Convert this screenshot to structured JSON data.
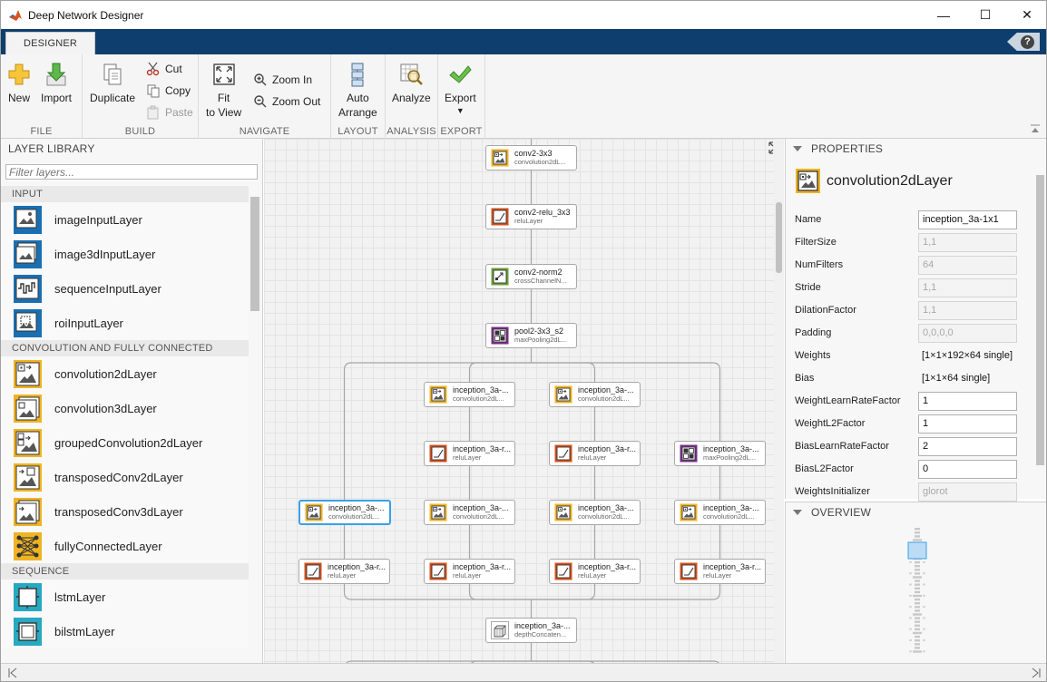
{
  "window": {
    "title": "Deep Network Designer",
    "minimize_symbol": "—",
    "maximize_symbol": "☐",
    "close_symbol": "✕"
  },
  "tab": {
    "label": "DESIGNER"
  },
  "help": {
    "symbol": "?"
  },
  "toolstrip": {
    "file": {
      "label": "FILE",
      "new": "New",
      "import": "Import"
    },
    "build": {
      "label": "BUILD",
      "duplicate": "Duplicate",
      "cut": "Cut",
      "copy": "Copy",
      "paste": "Paste"
    },
    "navigate": {
      "label": "NAVIGATE",
      "fit_line1": "Fit",
      "fit_line2": "to View",
      "zoom_in": "Zoom In",
      "zoom_out": "Zoom Out"
    },
    "layout": {
      "label": "LAYOUT",
      "auto_line1": "Auto",
      "auto_line2": "Arrange"
    },
    "analysis": {
      "label": "ANALYSIS",
      "analyze": "Analyze"
    },
    "export": {
      "label": "EXPORT",
      "export": "Export"
    }
  },
  "library": {
    "title": "LAYER LIBRARY",
    "filter_placeholder": "Filter layers...",
    "categories": [
      {
        "name": "INPUT",
        "color": "#1a6fb3",
        "layers": [
          "imageInputLayer",
          "image3dInputLayer",
          "sequenceInputLayer",
          "roiInputLayer"
        ]
      },
      {
        "name": "CONVOLUTION AND FULLY CONNECTED",
        "color": "#f0b323",
        "layers": [
          "convolution2dLayer",
          "convolution3dLayer",
          "groupedConvolution2dLayer",
          "transposedConv2dLayer",
          "transposedConv3dLayer",
          "fullyConnectedLayer"
        ]
      },
      {
        "name": "SEQUENCE",
        "color": "#27a9c2",
        "layers": [
          "lstmLayer",
          "bilstmLayer"
        ]
      }
    ]
  },
  "network": {
    "nodes": [
      {
        "name": "conv2-3x3",
        "type": "convolution2dL...",
        "kind": "conv"
      },
      {
        "name": "conv2-relu_3x3",
        "type": "reluLayer",
        "kind": "relu"
      },
      {
        "name": "conv2-norm2",
        "type": "crossChannelN...",
        "kind": "norm"
      },
      {
        "name": "pool2-3x3_s2",
        "type": "maxPooling2dL...",
        "kind": "pool"
      },
      {
        "name": "inception_3a-...",
        "type": "convolution2dL...",
        "kind": "conv"
      },
      {
        "name": "inception_3a-...",
        "type": "convolution2dL...",
        "kind": "conv"
      },
      {
        "name": "inception_3a-r...",
        "type": "reluLayer",
        "kind": "relu"
      },
      {
        "name": "inception_3a-r...",
        "type": "reluLayer",
        "kind": "relu"
      },
      {
        "name": "inception_3a-...",
        "type": "maxPooling2dL...",
        "kind": "pool"
      },
      {
        "name": "inception_3a-...",
        "type": "convolution2dL...",
        "kind": "conv"
      },
      {
        "name": "inception_3a-...",
        "type": "convolution2dL...",
        "kind": "conv"
      },
      {
        "name": "inception_3a-...",
        "type": "convolution2dL...",
        "kind": "conv"
      },
      {
        "name": "inception_3a-...",
        "type": "convolution2dL...",
        "kind": "conv"
      },
      {
        "name": "inception_3a-r...",
        "type": "reluLayer",
        "kind": "relu"
      },
      {
        "name": "inception_3a-r...",
        "type": "reluLayer",
        "kind": "relu"
      },
      {
        "name": "inception_3a-r...",
        "type": "reluLayer",
        "kind": "relu"
      },
      {
        "name": "inception_3a-r...",
        "type": "reluLayer",
        "kind": "relu"
      },
      {
        "name": "inception_3a-...",
        "type": "depthConcaten...",
        "kind": "concat"
      }
    ],
    "selected_index": 9
  },
  "properties": {
    "title": "PROPERTIES",
    "layer_type": "convolution2dLayer",
    "rows": [
      {
        "label": "Name",
        "value": "inception_3a-1x1",
        "mode": "edit"
      },
      {
        "label": "FilterSize",
        "value": "1,1",
        "mode": "disabled"
      },
      {
        "label": "NumFilters",
        "value": "64",
        "mode": "disabled"
      },
      {
        "label": "Stride",
        "value": "1,1",
        "mode": "disabled"
      },
      {
        "label": "DilationFactor",
        "value": "1,1",
        "mode": "disabled"
      },
      {
        "label": "Padding",
        "value": "0,0,0,0",
        "mode": "disabled"
      },
      {
        "label": "Weights",
        "value": "[1×1×192×64 single]",
        "mode": "text"
      },
      {
        "label": "Bias",
        "value": "[1×1×64 single]",
        "mode": "text"
      },
      {
        "label": "WeightLearnRateFactor",
        "value": "1",
        "mode": "edit"
      },
      {
        "label": "WeightL2Factor",
        "value": "1",
        "mode": "edit"
      },
      {
        "label": "BiasLearnRateFactor",
        "value": "2",
        "mode": "edit"
      },
      {
        "label": "BiasL2Factor",
        "value": "0",
        "mode": "edit"
      },
      {
        "label": "WeightsInitializer",
        "value": "glorot",
        "mode": "disabled"
      }
    ]
  },
  "overview": {
    "title": "OVERVIEW"
  },
  "colors": {
    "conv": "#f0b323",
    "relu": "#d2501e",
    "norm": "#6aa034",
    "pool": "#7b2d8e",
    "concat": "#9a9a9a",
    "tab_strip": "#0e3e6e",
    "selection": "#3aa0e6"
  }
}
